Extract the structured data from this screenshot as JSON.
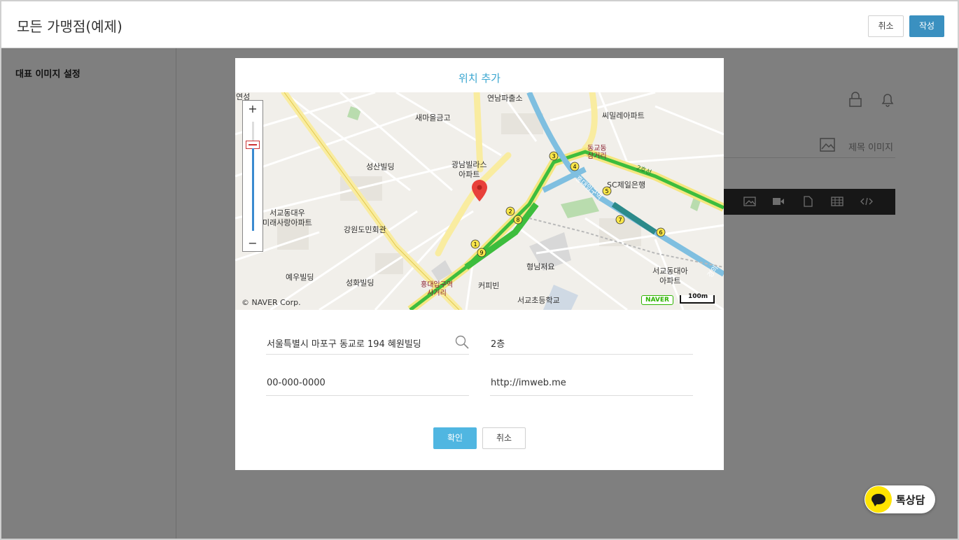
{
  "header": {
    "title": "모든 가맹점(예제)",
    "cancel_label": "취소",
    "write_label": "작성"
  },
  "sidebar": {
    "label": "대표 이미지 설정"
  },
  "background": {
    "title_image_label": "제목 이미지"
  },
  "modal": {
    "title": "위치 추가",
    "address": "서울특별시 마포구 동교로 194 혜원빌딩",
    "address_detail": "2층",
    "phone": "00-000-0000",
    "website": "http://imweb.me",
    "confirm_label": "확인",
    "cancel_label": "취소"
  },
  "map": {
    "copyright": "© NAVER Corp.",
    "brand": "NAVER",
    "scale": "100m",
    "zoom_in": "+",
    "zoom_out": "−",
    "labels": {
      "yeonnam": "연남파출소",
      "saemaeul": "새마을금고",
      "ssimil": "씨밀레아파트",
      "donggyo_samgeori": "동교동\n삼거리",
      "line2": "2호선",
      "seongsan": "성산빌딩",
      "gwangnam": "광남빌라스\n아파트",
      "sc_bank": "SC제일은행",
      "seogyo_mirae": "서교동대우\n미래사랑아파트",
      "gangwon": "강원도민회관",
      "hongdae_station": "홍대입구역",
      "yewoo": "예우빌딩",
      "seonghwa": "성화빌딩",
      "hongdae_samgeori": "홍대입구역\n사거리",
      "coffee_bean": "커피빈",
      "hyeongnim": "형님저요",
      "seogyo_school": "서교초등학교",
      "seogyo_daea": "서교동대아\n아파트",
      "yeonseong": "연성",
      "gyeongui": "경의"
    }
  },
  "kakao": {
    "label": "톡상담"
  }
}
